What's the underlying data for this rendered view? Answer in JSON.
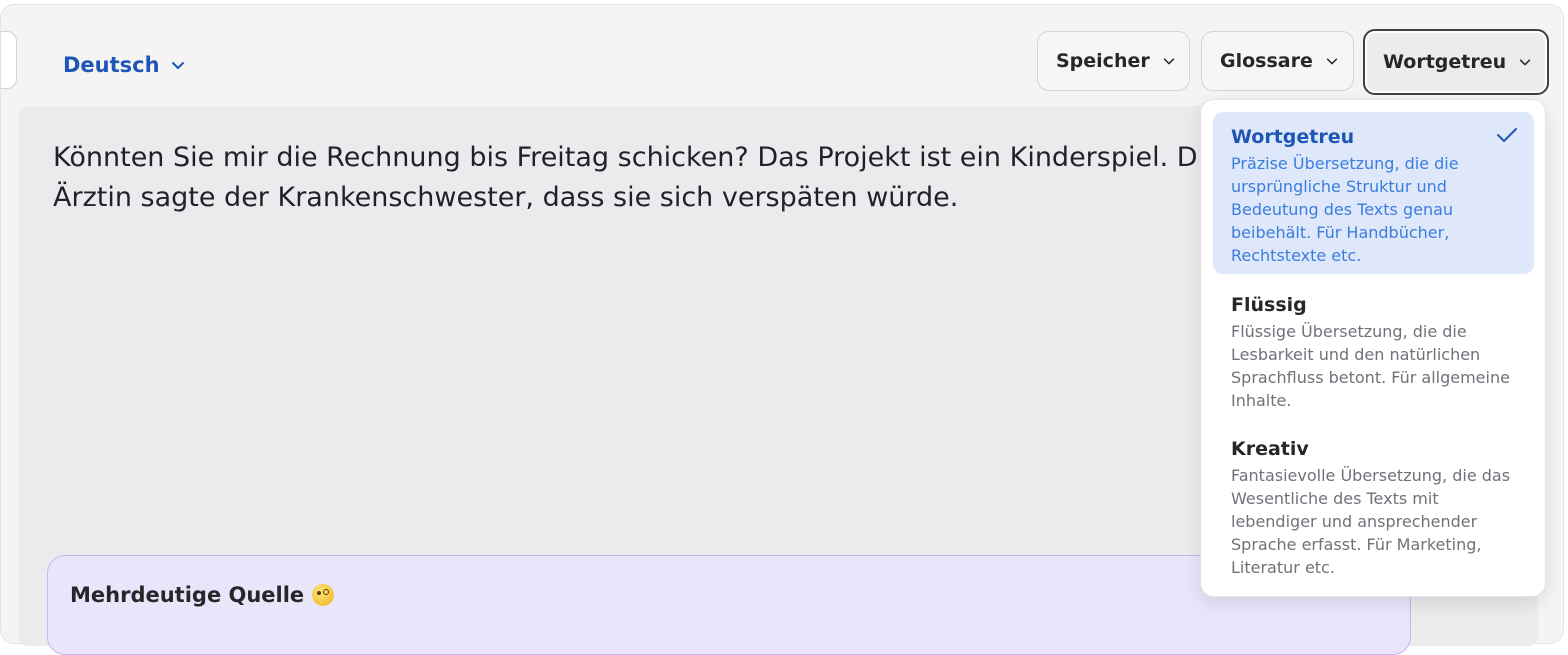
{
  "language_selector": {
    "label": "Deutsch"
  },
  "toolbar": {
    "memory_label": "Speicher",
    "glossary_label": "Glossare",
    "style_label": "Wortgetreu"
  },
  "source_text": "Könnten Sie mir die Rechnung bis Freitag schicken? Das Projekt ist ein Kinderspiel. Die Ärztin sagte der Krankenschwester, dass sie sich verspäten würde.",
  "ambiguity_card": {
    "title": "Mehrdeutige Quelle"
  },
  "style_dropdown": {
    "options": [
      {
        "title": "Wortgetreu",
        "description": "Präzise Übersetzung, die die ursprüngliche Struktur und Bedeutung des Texts genau beibehält. Für Handbücher, Rechtstexte etc.",
        "selected": true
      },
      {
        "title": "Flüssig",
        "description": "Flüssige Übersetzung, die die Lesbarkeit und den natürlichen Sprachfluss betont. Für allgemeine Inhalte.",
        "selected": false
      },
      {
        "title": "Kreativ",
        "description": "Fantasievolle Übersetzung, die das Wesentliche des Texts mit lebendiger und ansprechender Sprache erfasst. Für Marketing, Literatur etc.",
        "selected": false
      }
    ]
  },
  "icons": {
    "chevron": "chevron-down-icon",
    "check": "check-icon",
    "emoji": "face-with-monocle-icon"
  },
  "colors": {
    "accent": "#1e56b5",
    "selected_bg": "#dfe8fb",
    "card_bg": "#e9e5fb"
  }
}
